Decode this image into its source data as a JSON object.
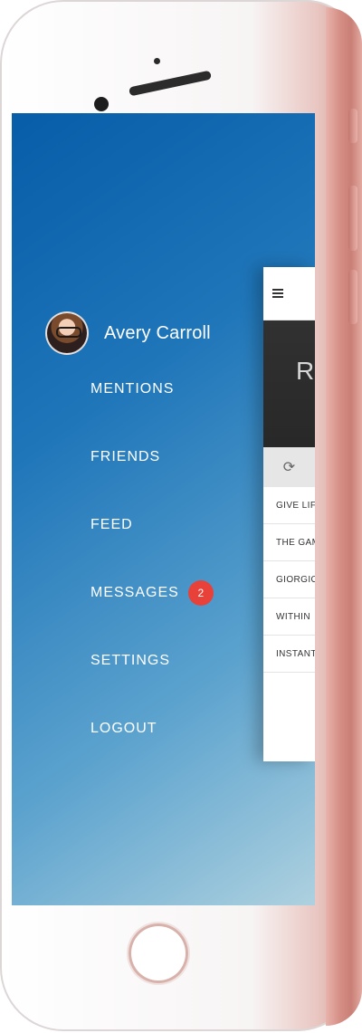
{
  "profile": {
    "name": "Avery Carroll"
  },
  "menu": {
    "items": [
      {
        "label": "MENTIONS"
      },
      {
        "label": "FRIENDS"
      },
      {
        "label": "FEED"
      },
      {
        "label": "MESSAGES",
        "badge": "2"
      },
      {
        "label": "SETTINGS"
      },
      {
        "label": "LOGOUT"
      }
    ]
  },
  "app_panel": {
    "hero_title": "Ra",
    "songs": [
      {
        "title": "GIVE LIFE"
      },
      {
        "title": "THE GAME"
      },
      {
        "title": "GIORGIO"
      },
      {
        "title": "WITHIN"
      },
      {
        "title": "INSTANT C"
      }
    ]
  },
  "icons": {
    "menu": "hamburger-icon",
    "repeat": "repeat-icon"
  },
  "colors": {
    "drawer_gradient_start": "#075da8",
    "drawer_gradient_end": "#aed1df",
    "badge": "#e7413a",
    "phone_edge": "#d58e85"
  }
}
